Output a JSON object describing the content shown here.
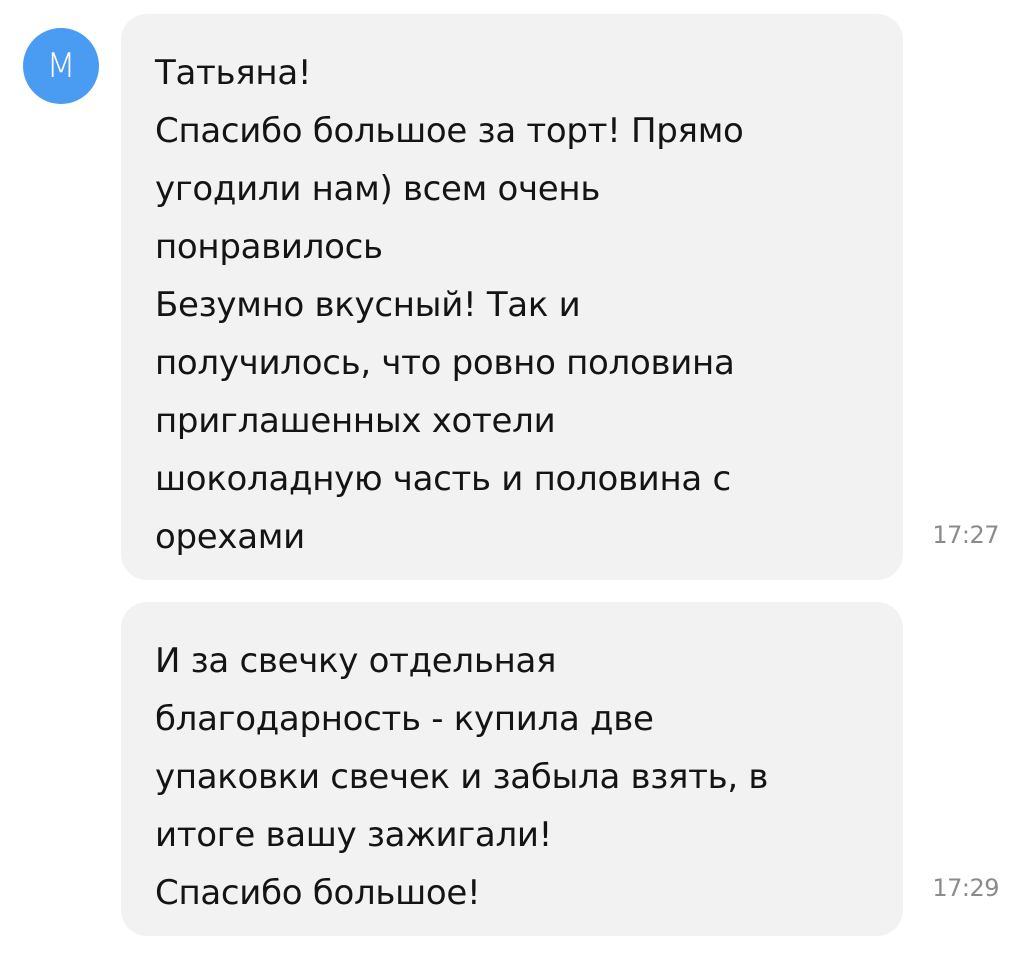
{
  "chat": {
    "sender_initial": "М",
    "messages": [
      {
        "text": "Татьяна!\nСпасибо большое за торт! Прямо\nугодили нам) всем очень\nпонравилось\nБезумно вкусный! Так и\nполучилось, что ровно половина\nприглашенных хотели\nшоколадную часть и половина с\nорехами",
        "time": "17:27"
      },
      {
        "text": "И за свечку отдельная\nблагодарность - купила две\nупаковки свечек и забыла взять, в\nитоге вашу зажигали!\nСпасибо большое!",
        "time": "17:29"
      }
    ]
  },
  "colors": {
    "avatar_bg": "#4a9cf2",
    "bubble_bg": "#f2f2f2",
    "text": "#141414",
    "time": "#8b8b8b"
  }
}
